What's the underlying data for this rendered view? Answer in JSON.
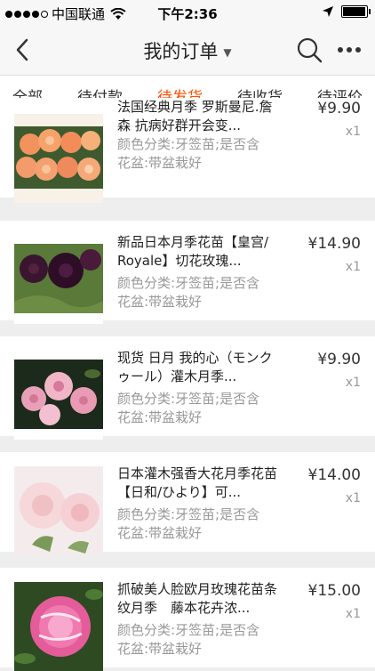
{
  "status_bar": {
    "carrier": "中国联通",
    "time": "下午2:36"
  },
  "nav": {
    "title": "我的订单",
    "title_caret": "▼"
  },
  "tabs": [
    {
      "label": "全部"
    },
    {
      "label": "待付款"
    },
    {
      "label": "待发货"
    },
    {
      "label": "待收货"
    },
    {
      "label": "待评价"
    }
  ],
  "accent_color": "#ff5000",
  "items": [
    {
      "title": "法国经典月季 罗斯曼尼.詹森 抗病好群开会变...",
      "spec1": "颜色分类:牙签苗;是否含",
      "spec2": "花盆:带盆栽好",
      "price": "¥9.90",
      "qty": "x1"
    },
    {
      "title": "新品日本月季花苗【皇宫/Royale】切花玫瑰...",
      "spec1": "颜色分类:牙签苗;是否含",
      "spec2": "花盆:带盆栽好",
      "price": "¥14.90",
      "qty": "x1"
    },
    {
      "title": "现货 日月 我的心（モンクゥール）灌木月季...",
      "spec1": "颜色分类:牙签苗;是否含",
      "spec2": "花盆:带盆栽好",
      "price": "¥9.90",
      "qty": "x1"
    },
    {
      "title": "日本灌木强香大花月季花苗【日和/ひより】可...",
      "spec1": "颜色分类:牙签苗;是否含",
      "spec2": "花盆:带盆栽好",
      "price": "¥14.00",
      "qty": "x1"
    },
    {
      "title": "抓破美人脸欧月玫瑰花苗条纹月季　藤本花卉浓...",
      "spec1": "颜色分类:牙签苗;是否含",
      "spec2": "花盆:带盆栽好",
      "price": "¥15.00",
      "qty": "x1"
    }
  ]
}
